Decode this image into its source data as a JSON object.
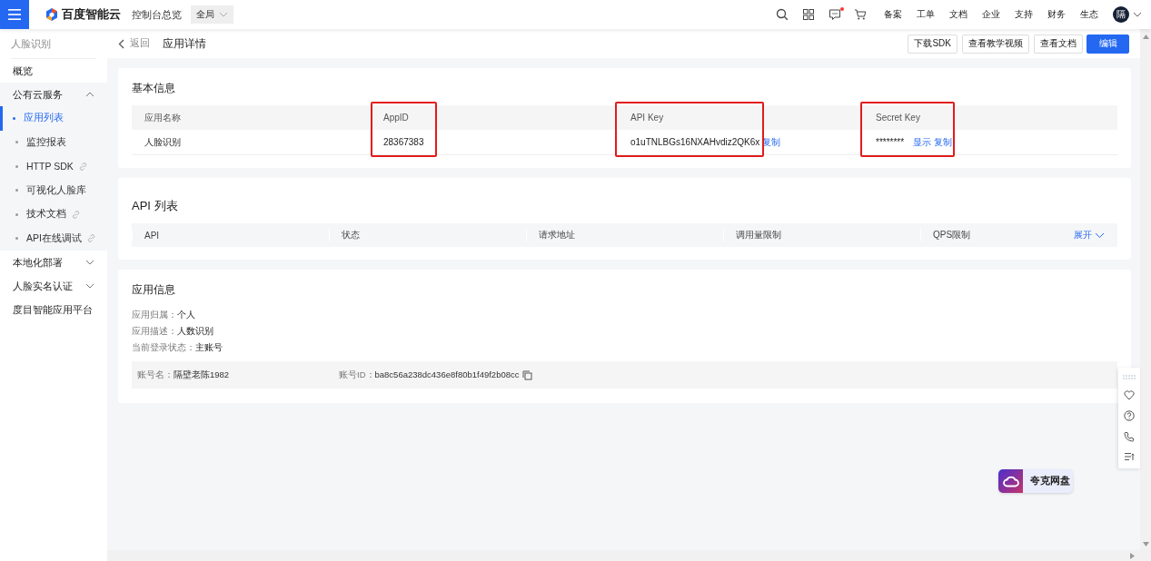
{
  "topbar": {
    "brand": "百度智能云",
    "console": "控制台总览",
    "region": "全局",
    "nav": [
      "备案",
      "工单",
      "文档",
      "企业",
      "支持",
      "财务",
      "生态"
    ],
    "avatar": "隔",
    "has_notification": true
  },
  "sidebar": {
    "title": "人脸识别",
    "items": [
      {
        "kind": "item",
        "label": "概览",
        "selected": false
      },
      {
        "kind": "group",
        "label": "公有云服务",
        "expanded": true,
        "children": [
          {
            "label": "应用列表",
            "selected": true,
            "link": false
          },
          {
            "label": "监控报表",
            "selected": false,
            "link": false
          },
          {
            "label": "HTTP SDK",
            "selected": false,
            "link": true
          },
          {
            "label": "可视化人脸库",
            "selected": false,
            "link": false
          },
          {
            "label": "技术文档",
            "selected": false,
            "link": true
          },
          {
            "label": "API在线调试",
            "selected": false,
            "link": true
          }
        ]
      },
      {
        "kind": "group",
        "label": "本地化部署",
        "expanded": false
      },
      {
        "kind": "group",
        "label": "人脸实名认证",
        "expanded": false
      },
      {
        "kind": "item",
        "label": "度目智能应用平台",
        "selected": false
      }
    ]
  },
  "header": {
    "back": "返回",
    "title": "应用详情",
    "buttons": [
      {
        "label": "下载SDK",
        "primary": false
      },
      {
        "label": "查看教学视频",
        "primary": false
      },
      {
        "label": "查看文档",
        "primary": false
      },
      {
        "label": "编辑",
        "primary": true
      }
    ]
  },
  "basic_info": {
    "title": "基本信息",
    "columns": [
      {
        "heading": "应用名称",
        "value": "人脸识别",
        "highlighted": false
      },
      {
        "heading": "AppID",
        "value": "28367383",
        "highlighted": true
      },
      {
        "heading": "API Key",
        "value": "o1uTNLBGs16NXAHvdiz2QK6x",
        "links": [
          "复制"
        ],
        "highlighted": true
      },
      {
        "heading": "Secret Key",
        "value": "********",
        "links": [
          "显示",
          "复制"
        ],
        "highlighted": true
      }
    ]
  },
  "api_list": {
    "title": "API 列表",
    "columns": [
      "API",
      "状态",
      "请求地址",
      "调用量限制",
      "QPS限制"
    ],
    "expand": "展开"
  },
  "app_info": {
    "title": "应用信息",
    "lines": [
      {
        "label": "应用归属：",
        "value": "个人"
      },
      {
        "label": "应用描述：",
        "value": "人数识别"
      },
      {
        "label": "当前登录状态：",
        "value": "主账号"
      }
    ],
    "account": [
      {
        "label": "账号名：",
        "value": "隔壁老陈1982",
        "copy": false
      },
      {
        "label": "账号ID：",
        "value": "ba8c56a238dc436e8f80b1f49f2b08cc",
        "copy": true
      }
    ]
  },
  "floating_badge": {
    "label": "夸克网盘"
  }
}
